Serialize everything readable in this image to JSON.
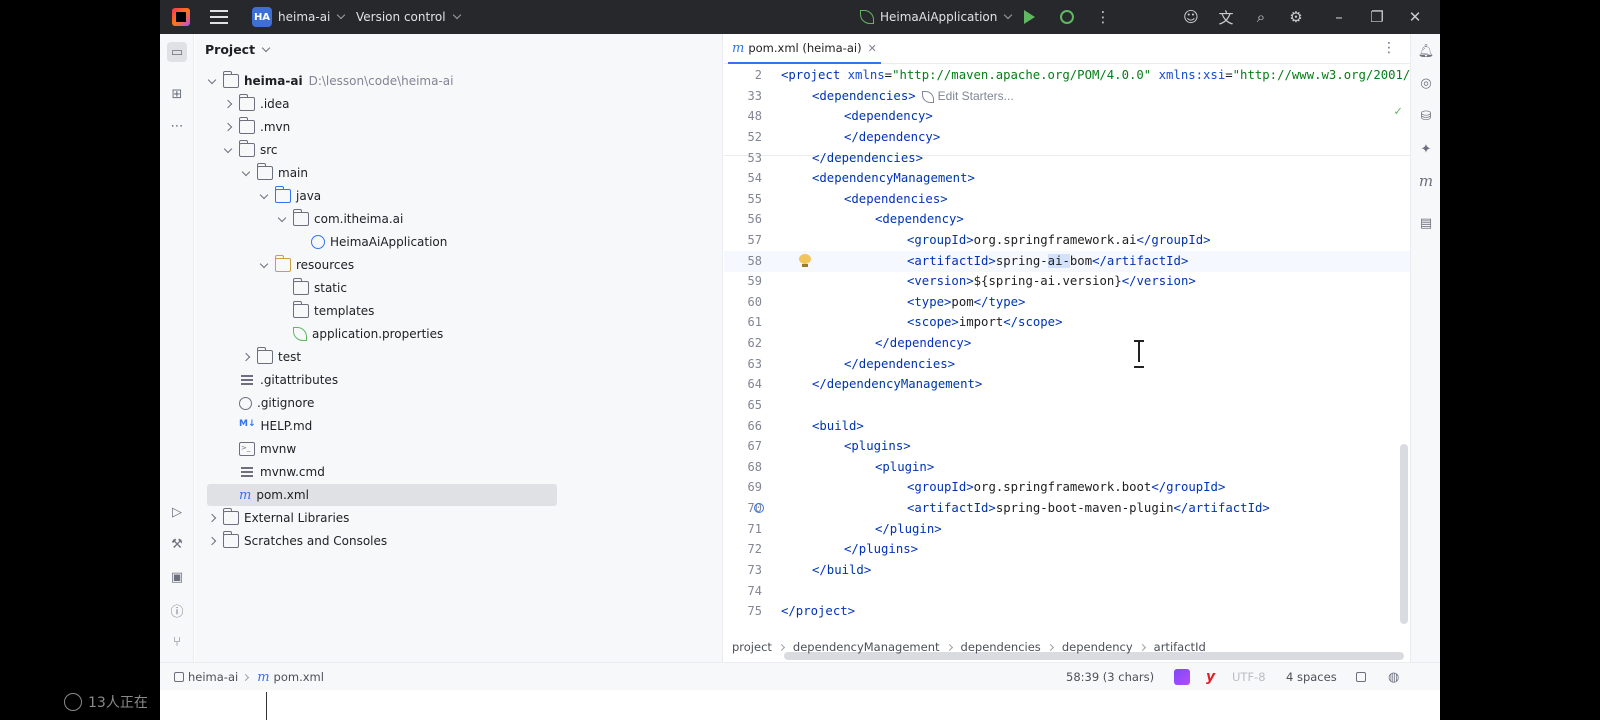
{
  "titlebar": {
    "project_badge": "HA",
    "project_name": "heima-ai",
    "vcs": "Version control",
    "run_config": "HeimaAiApplication"
  },
  "project_panel": {
    "title": "Project",
    "root_name": "heima-ai",
    "root_path": "D:\\lesson\\code\\heima-ai",
    "items": [
      {
        "label": ".idea"
      },
      {
        "label": ".mvn"
      },
      {
        "label": "src"
      },
      {
        "label": "main"
      },
      {
        "label": "java"
      },
      {
        "label": "com.itheima.ai"
      },
      {
        "label": "HeimaAiApplication"
      },
      {
        "label": "resources"
      },
      {
        "label": "static"
      },
      {
        "label": "templates"
      },
      {
        "label": "application.properties"
      },
      {
        "label": "test"
      },
      {
        "label": ".gitattributes"
      },
      {
        "label": ".gitignore"
      },
      {
        "label": "HELP.md"
      },
      {
        "label": "mvnw"
      },
      {
        "label": "mvnw.cmd"
      },
      {
        "label": "pom.xml"
      },
      {
        "label": "External Libraries"
      },
      {
        "label": "Scratches and Consoles"
      }
    ]
  },
  "editor": {
    "tab_label": "pom.xml (heima-ai)",
    "edit_starters": "Edit Starters...",
    "line_numbers": [
      "2",
      "33",
      "48",
      "52",
      "53",
      "54",
      "55",
      "56",
      "57",
      "58",
      "59",
      "60",
      "61",
      "62",
      "63",
      "64",
      "65",
      "66",
      "67",
      "68",
      "69",
      "70",
      "71",
      "72",
      "73",
      "74",
      "75"
    ],
    "breadcrumbs": [
      "project",
      "dependencyManagement",
      "dependencies",
      "dependency",
      "artifactId"
    ]
  },
  "statusbar": {
    "project": "heima-ai",
    "file": "pom.xml",
    "position": "58:39 (3 chars)",
    "indent": "4 spaces",
    "encoding": "UTF-8"
  },
  "overlay": {
    "viewers": "13人正在"
  },
  "colors": {
    "accent": "#3574f0",
    "tag": "#0033b3",
    "string": "#067d17",
    "run_green": "#5fb85f"
  }
}
